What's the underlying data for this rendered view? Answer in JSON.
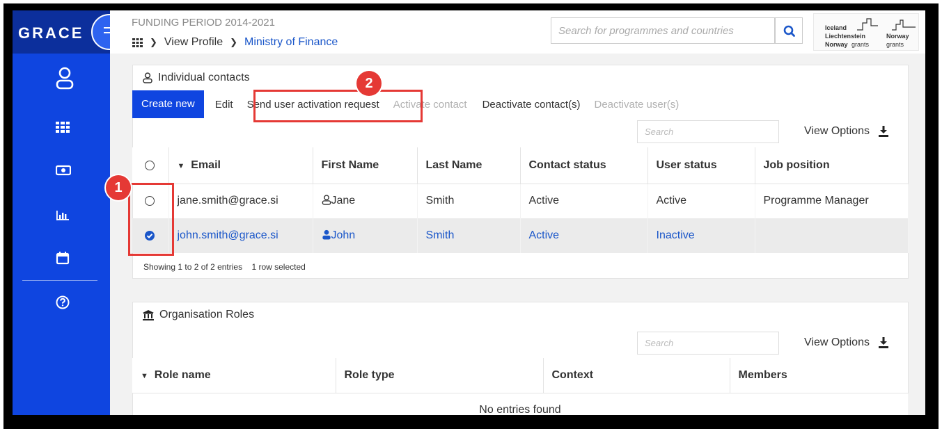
{
  "app": {
    "logo": "GRACE"
  },
  "header": {
    "funding_period": "FUNDING PERIOD 2014-2021",
    "breadcrumb": {
      "view_profile": "View Profile",
      "current": "Ministry of Finance"
    },
    "search_placeholder": "Search for programmes and countries",
    "grants_logo": {
      "line1": "Iceland",
      "line2": "Liechtenstein",
      "line3": "Norway",
      "line4a": "Norway",
      "line4b": "grants",
      "line5": "Norway",
      "line6": "grants"
    }
  },
  "contacts_panel": {
    "title": "Individual contacts",
    "toolbar": {
      "create_new": "Create new",
      "edit": "Edit",
      "send_activation": "Send user activation request",
      "activate_contact": "Activate contact",
      "deactivate_contacts": "Deactivate contact(s)",
      "deactivate_users": "Deactivate user(s)"
    },
    "search_placeholder": "Search",
    "view_options": "View Options",
    "columns": [
      "Email",
      "First Name",
      "Last Name",
      "Contact status",
      "User status",
      "Job position"
    ],
    "rows": [
      {
        "email": "jane.smith@grace.si",
        "first_name": "Jane",
        "last_name": "Smith",
        "contact_status": "Active",
        "user_status": "Active",
        "job_position": "Programme Manager",
        "selected": false
      },
      {
        "email": "john.smith@grace.si",
        "first_name": "John",
        "last_name": "Smith",
        "contact_status": "Active",
        "user_status": "Inactive",
        "job_position": "",
        "selected": true
      }
    ],
    "entries_info": "Showing 1 to 2 of 2 entries",
    "selection_info": "1 row selected"
  },
  "roles_panel": {
    "title": "Organisation Roles",
    "search_placeholder": "Search",
    "view_options": "View Options",
    "columns": [
      "Role name",
      "Role type",
      "Context",
      "Members"
    ],
    "empty_text": "No entries found"
  },
  "annotations": {
    "badge1": "1",
    "badge2": "2"
  },
  "colors": {
    "sidebar": "#0f45e0",
    "logo_bar": "#0c2f9c",
    "link": "#1a56c9",
    "annotation": "#e53935"
  }
}
